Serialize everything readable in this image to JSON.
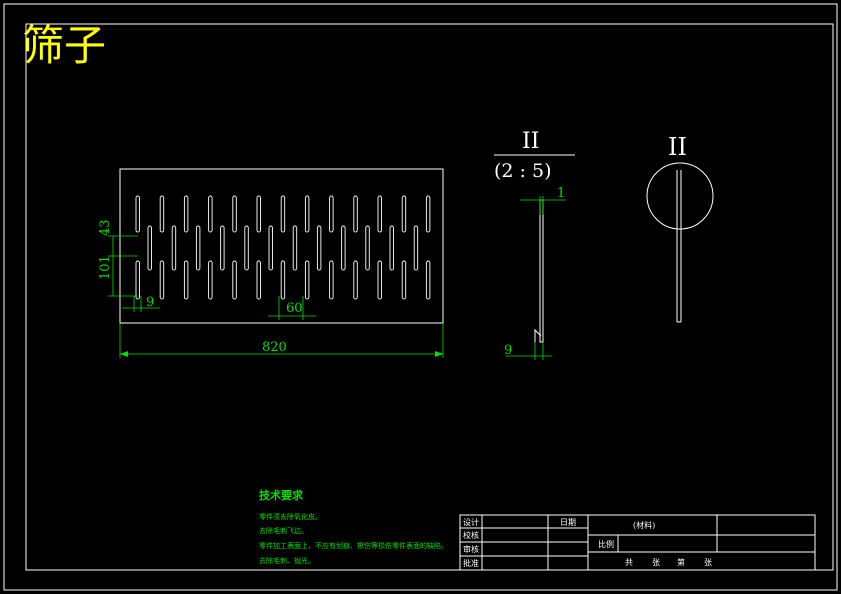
{
  "title": "筛子",
  "plate_view": {
    "dimensions": {
      "height_top": "43",
      "height_full": "101",
      "slot_width": "9",
      "pitch": "60",
      "length": "820"
    }
  },
  "side_view": {
    "label": "II",
    "scale": "(2 : 5)",
    "thickness": "1",
    "bottom_dim": "9"
  },
  "detail_view": {
    "label": "II"
  },
  "tech_requirements": {
    "heading": "技术要求",
    "items": [
      "零件须去除氧化皮。",
      "去除毛刺飞边。",
      "零件加工表面上，不应有划痕、擦伤等损伤零件表面的缺陷。",
      "去除毛刺、抛光。"
    ]
  },
  "title_block": {
    "rows": [
      "设计",
      "校核",
      "审核",
      "批准"
    ],
    "date_label": "日期",
    "material": "(材料)",
    "scale_label": "比例",
    "sheet_labels": [
      "共",
      "张",
      "第",
      "张"
    ]
  },
  "colors": {
    "background": "#000000",
    "outline": "#ffffff",
    "dimension": "#00e000",
    "title": "#ffff00"
  }
}
